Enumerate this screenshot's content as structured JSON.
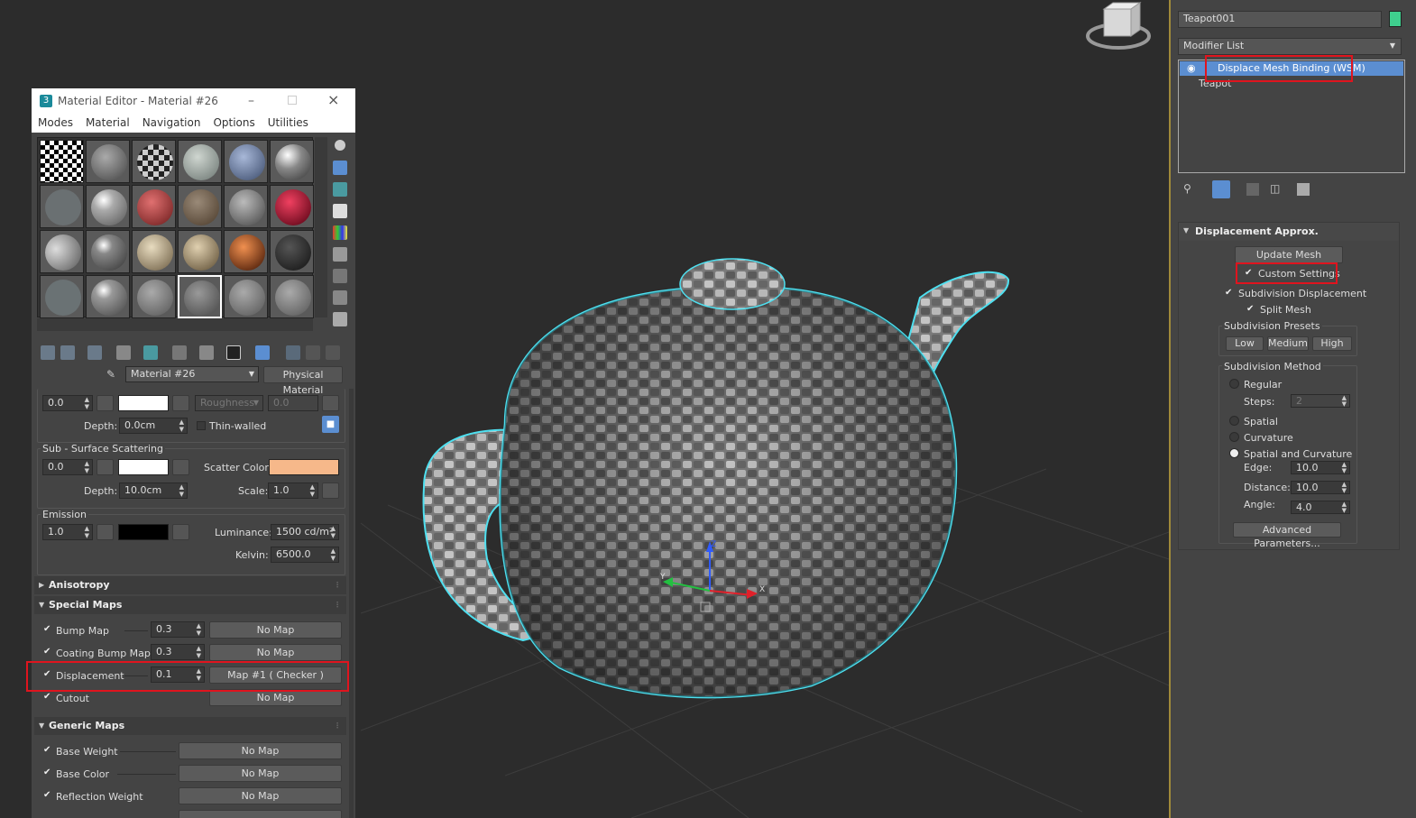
{
  "material_editor": {
    "window_title": "Material Editor - Material #26",
    "menu": [
      "Modes",
      "Material",
      "Navigation",
      "Options",
      "Utilities"
    ],
    "material_name": "Material #26",
    "material_type": "Physical Material",
    "top_row": {
      "value": "0.0",
      "roughness_label": "Roughness",
      "roughness_value": "0.0"
    },
    "depth_row": {
      "depth_label": "Depth:",
      "depth_value": "0.0cm",
      "thin_walled": "Thin-walled"
    },
    "subsurface": {
      "title": "Sub - Surface Scattering",
      "value": "0.0",
      "scatter_color_label": "Scatter Color:",
      "scatter_color": "#f6b88a",
      "depth_label": "Depth:",
      "depth_value": "10.0cm",
      "scale_label": "Scale:",
      "scale_value": "1.0"
    },
    "emission": {
      "title": "Emission",
      "value": "1.0",
      "luminance_label": "Luminance:",
      "luminance_value": "1500 cd/m²",
      "kelvin_label": "Kelvin:",
      "kelvin_value": "6500.0"
    },
    "anisotropy_title": "Anisotropy",
    "special_maps": {
      "title": "Special Maps",
      "rows": [
        {
          "label": "Bump Map",
          "value": "0.3",
          "map": "No Map"
        },
        {
          "label": "Coating Bump Map",
          "value": "0.3",
          "map": "No Map"
        },
        {
          "label": "Displacement",
          "value": "0.1",
          "map": "Map #1  ( Checker )"
        },
        {
          "label": "Cutout",
          "value": "",
          "map": "No Map"
        }
      ]
    },
    "generic_maps": {
      "title": "Generic Maps",
      "rows": [
        {
          "label": "Base Weight",
          "map": "No Map"
        },
        {
          "label": "Base Color",
          "map": "No Map"
        },
        {
          "label": "Reflection Weight",
          "map": "No Map"
        }
      ]
    }
  },
  "command_panel": {
    "object_name": "Teapot001",
    "object_color": "#3fcf8e",
    "modifier_list_label": "Modifier List",
    "stack": [
      "Displace Mesh Binding (WSM)",
      "Teapot"
    ],
    "rollout_title": "Displacement Approx.",
    "update_mesh": "Update Mesh",
    "custom_settings": "Custom Settings",
    "subdivision_displacement": "Subdivision Displacement",
    "split_mesh": "Split Mesh",
    "presets": {
      "title": "Subdivision Presets",
      "buttons": [
        "Low",
        "Medium",
        "High"
      ]
    },
    "method": {
      "title": "Subdivision Method",
      "regular": "Regular",
      "steps_label": "Steps:",
      "steps_value": "2",
      "spatial": "Spatial",
      "curvature": "Curvature",
      "spatial_and_curvature": "Spatial and Curvature",
      "edge_label": "Edge:",
      "edge_value": "10.0",
      "distance_label": "Distance:",
      "distance_value": "10.0",
      "angle_label": "Angle:",
      "angle_value": "4.0"
    },
    "advanced_button": "Advanced Parameters..."
  },
  "gizmo_labels": {
    "z": "Z",
    "y": "Y",
    "x": "X"
  },
  "colors": {
    "highlight": "#e0141e",
    "selection_outline": "#4fe0f0",
    "stack_selected": "#5b8ed1"
  }
}
